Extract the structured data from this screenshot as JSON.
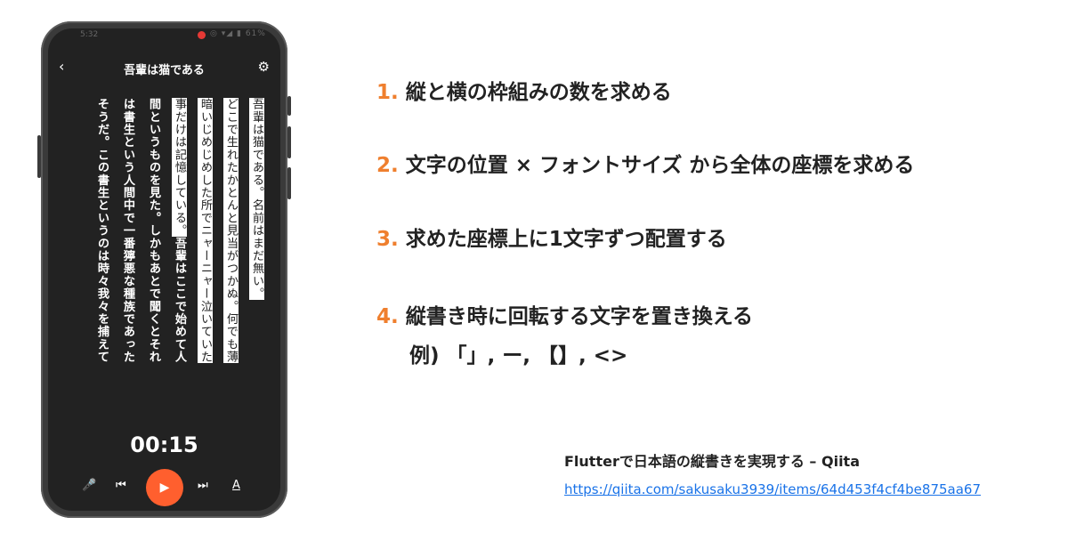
{
  "phone": {
    "status": {
      "time": "5:32",
      "icons": "◎ ▾◢ ▮ 61%"
    },
    "appbar": {
      "back_icon": "‹",
      "title": "吾輩は猫である",
      "settings_icon": "⚙"
    },
    "columns": [
      {
        "text": "吾輩は猫である。名前はまだ無い。",
        "highlight": true
      },
      {
        "text": "どこで生れたかとんと見当がつかぬ。何でも薄",
        "highlight": true
      },
      {
        "text": "暗いじめじめした所でニャーニャー泣いていた",
        "highlight": true
      },
      {
        "text": "事だけは記憶している。",
        "highlight": true,
        "rest": "吾輩はここで始めて人"
      },
      {
        "text": "",
        "highlight": false,
        "rest": "間というものを見た。しかもあとで聞くとそれ"
      },
      {
        "text": "",
        "highlight": false,
        "rest": "は書生という人間中で一番獰悪な種族であった"
      },
      {
        "text": "",
        "highlight": false,
        "rest": "そうだ。この書生というのは時々我々を捕えて"
      }
    ],
    "timer": "00:15",
    "controls": {
      "mic_icon": "🎤",
      "prev_icon": "⏮",
      "play_icon": "▶",
      "next_icon": "⏭",
      "font_icon": "A"
    }
  },
  "steps": [
    {
      "num": "1.",
      "text": "縦と横の枠組みの数を求める"
    },
    {
      "num": "2.",
      "text": "文字の位置 × フォントサイズ から全体の座標を求める"
    },
    {
      "num": "3.",
      "text": "求めた座標上に1文字ずつ配置する"
    },
    {
      "num": "4.",
      "text": "縦書き時に回転する文字を置き換える"
    }
  ],
  "example": "例) 「」, ー, 【】, <>",
  "reference": {
    "title": "Flutterで日本語の縦書きを実現する – Qiita",
    "url": "https://qiita.com/sakusaku3939/items/64d453f4cf4be875aa67"
  },
  "colors": {
    "accent": "#ef7f2e",
    "play": "#ff5f2e",
    "link": "#1a73e8",
    "screen": "#222222"
  }
}
